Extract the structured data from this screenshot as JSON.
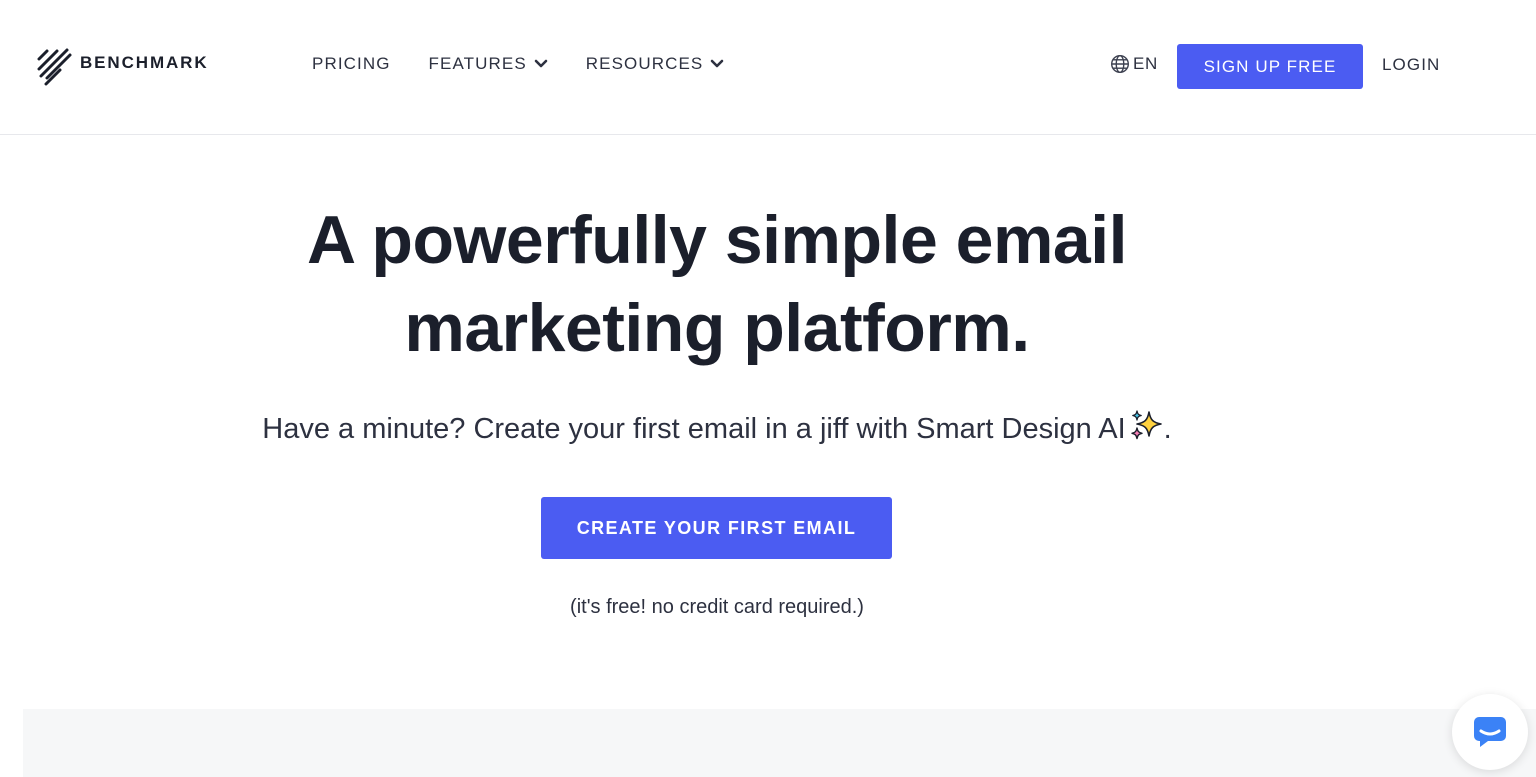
{
  "header": {
    "logo_text": "BENCHMARK",
    "nav": [
      {
        "label": "PRICING",
        "has_dropdown": false
      },
      {
        "label": "FEATURES",
        "has_dropdown": true
      },
      {
        "label": "RESOURCES",
        "has_dropdown": true
      }
    ],
    "language": {
      "label": "EN",
      "icon": "globe-icon"
    },
    "signup_label": "SIGN UP FREE",
    "login_label": "LOGIN"
  },
  "hero": {
    "title_line1": "A powerfully simple email",
    "title_line2": "marketing platform.",
    "subtitle": "Have a minute? Create your first email in a jiff with Smart Design AI",
    "subtitle_suffix": ".",
    "subtitle_icon": "sparkle-icon",
    "cta_label": "CREATE YOUR FIRST EMAIL",
    "note": "(it's free! no credit card required.)"
  },
  "chat_widget": {
    "icon": "chat-bubble-icon"
  },
  "colors": {
    "accent": "#4b5cf2",
    "text": "#1b1f2b",
    "band": "#f6f7f8",
    "chat_icon": "#3b82f6"
  }
}
